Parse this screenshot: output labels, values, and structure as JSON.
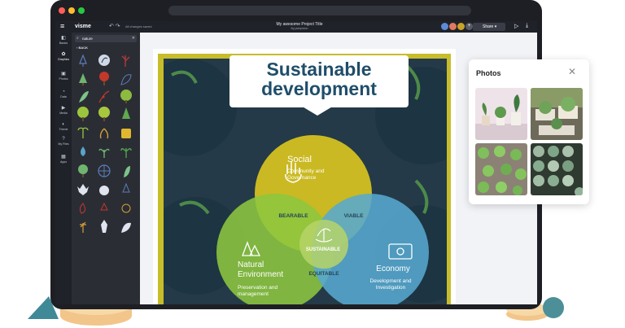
{
  "app": {
    "logo": "visme",
    "save_status": "All changes saved",
    "project_title": "My awesome Project Title",
    "project_author": "By jadepiston",
    "share_label": "Share"
  },
  "rail": {
    "items": [
      {
        "label": "Basics",
        "icon": "shapes-icon"
      },
      {
        "label": "Graphics",
        "icon": "graphics-icon"
      },
      {
        "label": "Photos",
        "icon": "photo-icon"
      },
      {
        "label": "Data",
        "icon": "chart-icon"
      },
      {
        "label": "Media",
        "icon": "media-icon"
      },
      {
        "label": "Theme",
        "icon": "palette-icon"
      },
      {
        "label": "My Files",
        "icon": "question-icon"
      },
      {
        "label": "Apps",
        "icon": "apps-icon"
      }
    ]
  },
  "library": {
    "search_value": "nature",
    "back_label": "BACK"
  },
  "slide": {
    "title_line1": "Sustainable",
    "title_line2": "development",
    "social_title": "Social",
    "social_desc": "Community and Governance",
    "natural_title": "Natural Environment",
    "natural_desc": "Preservation and management",
    "economy_title": "Economy",
    "economy_desc": "Development and Investigation",
    "bearable": "BEARABLE",
    "viable": "VIABLE",
    "sustainable": "SUSTAINABLE",
    "equitable": "EQUITABLE"
  },
  "photos_panel": {
    "title": "Photos",
    "close_icon": "close-icon",
    "items": [
      "plant-shelf-photo",
      "potted-plants-photo",
      "seedlings-photo",
      "succulent-trays-photo"
    ]
  },
  "colors": {
    "social": "#d7c31f",
    "natural": "#8cc63f",
    "economy": "#57a8cf",
    "title": "#1f4e6a",
    "frame": "#c7bd2c",
    "background": "#243a48"
  }
}
